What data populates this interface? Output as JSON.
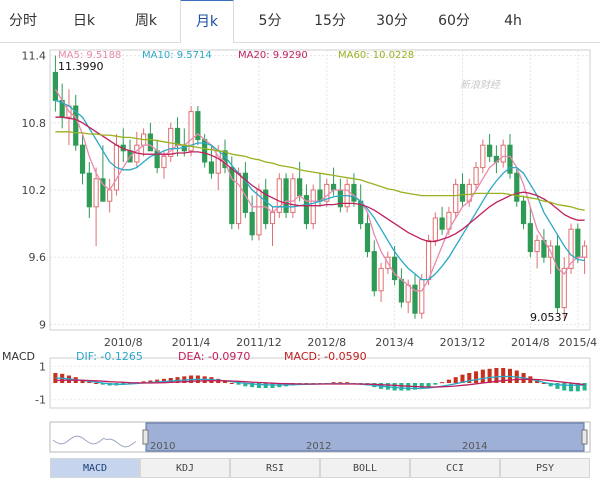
{
  "tabs": {
    "items": [
      {
        "label": "分时"
      },
      {
        "label": "日k"
      },
      {
        "label": "周k"
      },
      {
        "label": "月k"
      },
      {
        "label": "5分"
      },
      {
        "label": "15分"
      },
      {
        "label": "30分"
      },
      {
        "label": "60分"
      },
      {
        "label": "4h"
      }
    ],
    "active_index": 3
  },
  "watermark": "新浪财经",
  "ma_legend": [
    {
      "label": "MA5: 9.5188",
      "color": "#e88ab0"
    },
    {
      "label": "MA10: 9.5714",
      "color": "#2aa8c8"
    },
    {
      "label": "MA20: 9.9290",
      "color": "#c02060"
    },
    {
      "label": "MA60: 10.0228",
      "color": "#9ab020"
    }
  ],
  "max_label": "11.3990",
  "min_label": "9.0537",
  "macd_legend": [
    {
      "label": "MACD",
      "color": "#333333"
    },
    {
      "label": "DIF: -0.1265",
      "color": "#2aa8c8"
    },
    {
      "label": "DEA: -0.0970",
      "color": "#c02060"
    },
    {
      "label": "MACD: -0.0590",
      "color": "#c02020"
    }
  ],
  "navigator_labels": [
    "2010",
    "2012",
    "2014"
  ],
  "bottom_tabs": {
    "items": [
      {
        "label": "MACD"
      },
      {
        "label": "KDJ"
      },
      {
        "label": "RSI"
      },
      {
        "label": "BOLL"
      },
      {
        "label": "CCI"
      },
      {
        "label": "PSY"
      }
    ],
    "active_index": 0
  },
  "colors": {
    "up": "#e07070",
    "down": "#2e9a55",
    "ma5": "#e88ab0",
    "ma10": "#2aa8c8",
    "ma20": "#c02060",
    "ma60": "#9ab020",
    "macd_pos": "#c8301e",
    "macd_neg": "#25b58a"
  },
  "chart_data": [
    {
      "type": "candlestick",
      "title": "",
      "y_ticks": [
        9,
        9.6,
        10.2,
        10.8,
        11.4
      ],
      "ylim": [
        8.95,
        11.45
      ],
      "x_ticks": [
        "2010/8",
        "2011/4",
        "2011/12",
        "2012/8",
        "2013/4",
        "2013/12",
        "2014/8",
        "2015/4"
      ],
      "grid": true,
      "ohlc": [
        [
          11.25,
          11.399,
          10.9,
          11.0
        ],
        [
          11.0,
          11.15,
          10.75,
          10.85
        ],
        [
          10.85,
          11.1,
          10.6,
          10.95
        ],
        [
          10.95,
          11.05,
          10.55,
          10.6
        ],
        [
          10.6,
          10.7,
          10.25,
          10.35
        ],
        [
          10.35,
          10.45,
          9.95,
          10.05
        ],
        [
          10.05,
          10.4,
          9.7,
          10.3
        ],
        [
          10.3,
          10.6,
          10.1,
          10.1
        ],
        [
          10.1,
          10.3,
          10.0,
          10.2
        ],
        [
          10.2,
          10.7,
          10.15,
          10.6
        ],
        [
          10.6,
          10.75,
          10.45,
          10.55
        ],
        [
          10.55,
          10.65,
          10.45,
          10.45
        ],
        [
          10.45,
          10.72,
          10.4,
          10.6
        ],
        [
          10.6,
          10.75,
          10.5,
          10.7
        ],
        [
          10.7,
          10.8,
          10.55,
          10.55
        ],
        [
          10.55,
          10.65,
          10.35,
          10.4
        ],
        [
          10.4,
          10.55,
          10.3,
          10.5
        ],
        [
          10.5,
          10.8,
          10.45,
          10.75
        ],
        [
          10.75,
          10.85,
          10.5,
          10.6
        ],
        [
          10.6,
          10.75,
          10.5,
          10.55
        ],
        [
          10.55,
          10.95,
          10.5,
          10.9
        ],
        [
          10.9,
          10.95,
          10.6,
          10.65
        ],
        [
          10.65,
          10.7,
          10.4,
          10.45
        ],
        [
          10.45,
          10.6,
          10.3,
          10.35
        ],
        [
          10.35,
          10.6,
          10.2,
          10.55
        ],
        [
          10.55,
          10.65,
          10.35,
          10.4
        ],
        [
          10.4,
          10.5,
          9.85,
          9.9
        ],
        [
          9.9,
          10.4,
          9.85,
          10.35
        ],
        [
          10.35,
          10.45,
          9.95,
          10.0
        ],
        [
          10.0,
          10.15,
          9.75,
          9.8
        ],
        [
          9.8,
          10.25,
          9.75,
          10.2
        ],
        [
          10.2,
          10.3,
          9.85,
          9.9
        ],
        [
          9.9,
          10.05,
          9.7,
          10.0
        ],
        [
          10.0,
          10.35,
          9.95,
          10.3
        ],
        [
          10.3,
          10.35,
          9.95,
          10.0
        ],
        [
          10.0,
          10.35,
          9.95,
          10.3
        ],
        [
          10.3,
          10.45,
          10.1,
          10.15
        ],
        [
          10.15,
          10.25,
          9.85,
          9.9
        ],
        [
          9.9,
          10.25,
          9.85,
          10.2
        ],
        [
          10.2,
          10.35,
          10.05,
          10.1
        ],
        [
          10.1,
          10.3,
          10.05,
          10.25
        ],
        [
          10.25,
          10.4,
          10.15,
          10.2
        ],
        [
          10.2,
          10.3,
          10.0,
          10.05
        ],
        [
          10.05,
          10.3,
          10.0,
          10.25
        ],
        [
          10.25,
          10.35,
          10.05,
          10.1
        ],
        [
          10.1,
          10.25,
          9.85,
          9.9
        ],
        [
          9.9,
          10.0,
          9.6,
          9.65
        ],
        [
          9.65,
          9.75,
          9.25,
          9.3
        ],
        [
          9.3,
          9.55,
          9.2,
          9.5
        ],
        [
          9.5,
          9.65,
          9.45,
          9.6
        ],
        [
          9.6,
          9.7,
          9.35,
          9.4
        ],
        [
          9.4,
          9.5,
          9.15,
          9.2
        ],
        [
          9.2,
          9.4,
          9.1,
          9.35
        ],
        [
          9.35,
          9.45,
          9.05,
          9.1
        ],
        [
          9.1,
          9.45,
          9.05,
          9.4
        ],
        [
          9.4,
          9.8,
          9.35,
          9.75
        ],
        [
          9.75,
          10.0,
          9.7,
          9.95
        ],
        [
          9.95,
          10.05,
          9.8,
          9.85
        ],
        [
          9.85,
          10.05,
          9.8,
          10.0
        ],
        [
          10.0,
          10.3,
          9.95,
          10.25
        ],
        [
          10.25,
          10.35,
          10.05,
          10.1
        ],
        [
          10.1,
          10.3,
          10.05,
          10.25
        ],
        [
          10.25,
          10.45,
          10.2,
          10.4
        ],
        [
          10.4,
          10.65,
          10.35,
          10.6
        ],
        [
          10.6,
          10.7,
          10.45,
          10.5
        ],
        [
          10.5,
          10.6,
          10.35,
          10.45
        ],
        [
          10.45,
          10.65,
          10.4,
          10.6
        ],
        [
          10.6,
          10.7,
          10.3,
          10.35
        ],
        [
          10.35,
          10.4,
          10.05,
          10.1
        ],
        [
          10.1,
          10.15,
          9.85,
          9.9
        ],
        [
          9.9,
          10.05,
          9.6,
          9.65
        ],
        [
          9.65,
          9.8,
          9.5,
          9.75
        ],
        [
          9.75,
          9.85,
          9.55,
          9.6
        ],
        [
          9.6,
          9.75,
          9.45,
          9.7
        ],
        [
          9.7,
          9.8,
          9.1,
          9.15
        ],
        [
          9.15,
          9.6,
          9.0537,
          9.5
        ],
        [
          9.5,
          9.9,
          9.45,
          9.85
        ],
        [
          9.85,
          9.9,
          9.55,
          9.6
        ],
        [
          9.6,
          9.75,
          9.45,
          9.7
        ]
      ],
      "series": [
        {
          "name": "MA5",
          "values": [
            11.1,
            11.0,
            10.9,
            10.85,
            10.7,
            10.5,
            10.35,
            10.25,
            10.2,
            10.3,
            10.4,
            10.5,
            10.55,
            10.6,
            10.6,
            10.55,
            10.5,
            10.55,
            10.6,
            10.6,
            10.65,
            10.7,
            10.65,
            10.6,
            10.5,
            10.45,
            10.3,
            10.25,
            10.15,
            10.05,
            10.05,
            10.05,
            10.0,
            10.05,
            10.1,
            10.1,
            10.15,
            10.1,
            10.1,
            10.1,
            10.15,
            10.2,
            10.2,
            10.2,
            10.15,
            10.1,
            10.0,
            9.8,
            9.65,
            9.55,
            9.45,
            9.4,
            9.35,
            9.3,
            9.3,
            9.4,
            9.55,
            9.7,
            9.85,
            9.95,
            10.05,
            10.1,
            10.2,
            10.3,
            10.4,
            10.45,
            10.5,
            10.5,
            10.4,
            10.25,
            10.05,
            9.85,
            9.75,
            9.65,
            9.5,
            9.45,
            9.55,
            9.6,
            9.6
          ]
        },
        {
          "name": "MA10",
          "values": [
            11.0,
            10.98,
            10.95,
            10.9,
            10.85,
            10.75,
            10.65,
            10.55,
            10.45,
            10.4,
            10.38,
            10.38,
            10.4,
            10.45,
            10.5,
            10.52,
            10.55,
            10.57,
            10.57,
            10.58,
            10.6,
            10.62,
            10.62,
            10.6,
            10.55,
            10.5,
            10.42,
            10.35,
            10.28,
            10.2,
            10.15,
            10.1,
            10.05,
            10.05,
            10.05,
            10.05,
            10.06,
            10.07,
            10.08,
            10.1,
            10.12,
            10.14,
            10.15,
            10.15,
            10.14,
            10.1,
            10.03,
            9.95,
            9.85,
            9.75,
            9.65,
            9.57,
            9.5,
            9.45,
            9.4,
            9.4,
            9.45,
            9.52,
            9.6,
            9.7,
            9.8,
            9.9,
            10.0,
            10.1,
            10.2,
            10.28,
            10.35,
            10.4,
            10.4,
            10.35,
            10.25,
            10.15,
            10.0,
            9.9,
            9.8,
            9.7,
            9.62,
            9.58,
            9.57
          ]
        },
        {
          "name": "MA20",
          "values": [
            10.85,
            10.85,
            10.84,
            10.83,
            10.8,
            10.76,
            10.72,
            10.68,
            10.64,
            10.6,
            10.57,
            10.55,
            10.53,
            10.52,
            10.52,
            10.52,
            10.52,
            10.52,
            10.53,
            10.53,
            10.54,
            10.54,
            10.53,
            10.51,
            10.48,
            10.44,
            10.39,
            10.34,
            10.29,
            10.24,
            10.2,
            10.16,
            10.13,
            10.1,
            10.08,
            10.07,
            10.06,
            10.06,
            10.06,
            10.06,
            10.07,
            10.07,
            10.08,
            10.08,
            10.08,
            10.07,
            10.05,
            10.02,
            9.98,
            9.94,
            9.9,
            9.86,
            9.82,
            9.79,
            9.76,
            9.74,
            9.74,
            9.76,
            9.78,
            9.81,
            9.85,
            9.9,
            9.95,
            10.0,
            10.05,
            10.09,
            10.12,
            10.15,
            10.17,
            10.18,
            10.17,
            10.15,
            10.12,
            10.08,
            10.03,
            9.98,
            9.95,
            9.93,
            9.93
          ]
        },
        {
          "name": "MA60",
          "values": [
            10.72,
            10.72,
            10.72,
            10.71,
            10.71,
            10.7,
            10.7,
            10.69,
            10.69,
            10.68,
            10.67,
            10.67,
            10.66,
            10.65,
            10.65,
            10.64,
            10.63,
            10.62,
            10.61,
            10.6,
            10.59,
            10.58,
            10.57,
            10.56,
            10.55,
            10.54,
            10.52,
            10.51,
            10.5,
            10.48,
            10.47,
            10.45,
            10.44,
            10.42,
            10.41,
            10.4,
            10.38,
            10.37,
            10.36,
            10.35,
            10.34,
            10.33,
            10.32,
            10.31,
            10.3,
            10.29,
            10.27,
            10.25,
            10.23,
            10.21,
            10.2,
            10.18,
            10.17,
            10.16,
            10.15,
            10.15,
            10.15,
            10.15,
            10.15,
            10.15,
            10.16,
            10.16,
            10.17,
            10.17,
            10.17,
            10.17,
            10.17,
            10.16,
            10.15,
            10.14,
            10.13,
            10.12,
            10.1,
            10.09,
            10.07,
            10.06,
            10.05,
            10.03,
            10.02
          ]
        }
      ]
    },
    {
      "type": "bar",
      "title": "",
      "y_ticks": [
        1,
        -1
      ],
      "ylim": [
        -1.5,
        1.5
      ],
      "grid": true,
      "series": [
        {
          "name": "MACD",
          "values": [
            0.6,
            0.55,
            0.45,
            0.35,
            0.2,
            0.1,
            0.0,
            -0.1,
            -0.15,
            -0.15,
            -0.1,
            -0.05,
            0.0,
            0.1,
            0.15,
            0.2,
            0.25,
            0.3,
            0.35,
            0.4,
            0.45,
            0.45,
            0.4,
            0.35,
            0.25,
            0.15,
            0.0,
            -0.1,
            -0.2,
            -0.25,
            -0.3,
            -0.3,
            -0.3,
            -0.25,
            -0.2,
            -0.15,
            -0.1,
            -0.1,
            -0.05,
            -0.05,
            0.0,
            0.05,
            0.05,
            0.05,
            0.0,
            -0.05,
            -0.15,
            -0.25,
            -0.35,
            -0.4,
            -0.45,
            -0.45,
            -0.45,
            -0.4,
            -0.35,
            -0.25,
            -0.1,
            0.05,
            0.2,
            0.35,
            0.5,
            0.6,
            0.7,
            0.8,
            0.85,
            0.9,
            0.9,
            0.85,
            0.75,
            0.6,
            0.4,
            0.2,
            0.0,
            -0.2,
            -0.35,
            -0.45,
            -0.5,
            -0.5,
            -0.45
          ]
        },
        {
          "name": "DIF",
          "values": [
            0.3,
            0.28,
            0.25,
            0.2,
            0.15,
            0.1,
            0.05,
            0.0,
            -0.05,
            -0.08,
            -0.08,
            -0.06,
            -0.03,
            0.0,
            0.03,
            0.06,
            0.09,
            0.12,
            0.15,
            0.18,
            0.2,
            0.22,
            0.22,
            0.2,
            0.17,
            0.13,
            0.08,
            0.03,
            -0.02,
            -0.06,
            -0.09,
            -0.11,
            -0.12,
            -0.12,
            -0.11,
            -0.1,
            -0.09,
            -0.08,
            -0.07,
            -0.06,
            -0.05,
            -0.04,
            -0.04,
            -0.04,
            -0.05,
            -0.07,
            -0.1,
            -0.14,
            -0.19,
            -0.23,
            -0.27,
            -0.3,
            -0.32,
            -0.33,
            -0.33,
            -0.3,
            -0.25,
            -0.19,
            -0.12,
            -0.04,
            0.05,
            0.13,
            0.2,
            0.27,
            0.33,
            0.37,
            0.39,
            0.39,
            0.36,
            0.3,
            0.22,
            0.13,
            0.03,
            -0.05,
            -0.1,
            -0.13,
            -0.14,
            -0.13,
            -0.1265
          ]
        },
        {
          "name": "DEA",
          "values": [
            0.15,
            0.16,
            0.17,
            0.17,
            0.16,
            0.15,
            0.13,
            0.11,
            0.08,
            0.06,
            0.04,
            0.02,
            0.01,
            0.0,
            0.0,
            0.01,
            0.02,
            0.04,
            0.06,
            0.08,
            0.1,
            0.12,
            0.13,
            0.14,
            0.14,
            0.13,
            0.12,
            0.1,
            0.08,
            0.05,
            0.03,
            0.01,
            -0.01,
            -0.03,
            -0.04,
            -0.05,
            -0.06,
            -0.06,
            -0.06,
            -0.06,
            -0.06,
            -0.06,
            -0.06,
            -0.06,
            -0.06,
            -0.06,
            -0.07,
            -0.08,
            -0.1,
            -0.12,
            -0.14,
            -0.17,
            -0.19,
            -0.21,
            -0.23,
            -0.24,
            -0.24,
            -0.23,
            -0.21,
            -0.18,
            -0.14,
            -0.1,
            -0.05,
            0.0,
            0.05,
            0.1,
            0.14,
            0.18,
            0.21,
            0.22,
            0.22,
            0.21,
            0.18,
            0.14,
            0.09,
            0.04,
            0.0,
            -0.05,
            -0.097
          ]
        }
      ]
    }
  ]
}
